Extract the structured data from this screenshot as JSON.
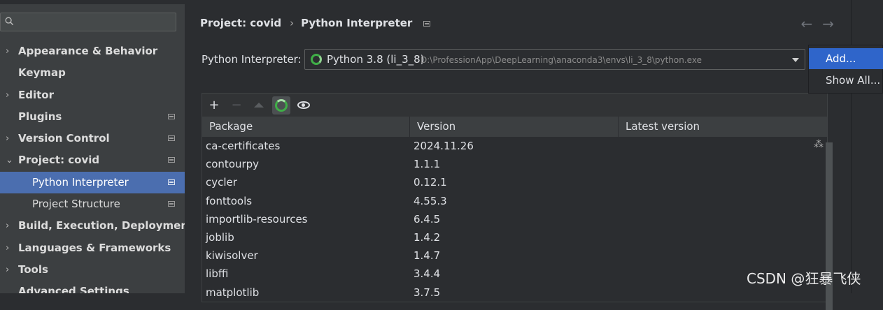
{
  "sidebar": {
    "search_placeholder": "",
    "items": [
      {
        "label": "Appearance & Behavior",
        "arrow": "›"
      },
      {
        "label": "Keymap"
      },
      {
        "label": "Editor",
        "arrow": "›"
      },
      {
        "label": "Plugins"
      },
      {
        "label": "Version Control",
        "arrow": "›"
      },
      {
        "label": "Project: covid",
        "arrow": "⌄"
      },
      {
        "label": "Python Interpreter"
      },
      {
        "label": "Project Structure"
      },
      {
        "label": "Build, Execution, Deployment",
        "arrow": "›"
      },
      {
        "label": "Languages & Frameworks",
        "arrow": "›"
      },
      {
        "label": "Tools",
        "arrow": "›"
      },
      {
        "label": "Advanced Settings"
      }
    ]
  },
  "breadcrumb": {
    "project": "Project: covid",
    "separator": "›",
    "page": "Python Interpreter"
  },
  "nav": {
    "back": "←",
    "forward": "→"
  },
  "interpreter": {
    "label": "Python Interpreter:",
    "name": "Python 3.8 (li_3_8)",
    "path": "D:\\ProfessionApp\\DeepLearning\\anaconda3\\envs\\li_3_8\\python.exe"
  },
  "toolbar": {
    "add": "+",
    "remove": "−"
  },
  "table": {
    "columns": [
      "Package",
      "Version",
      "Latest version"
    ],
    "rows": [
      {
        "package": "ca-certificates",
        "version": "2024.11.26"
      },
      {
        "package": "contourpy",
        "version": "1.1.1"
      },
      {
        "package": "cycler",
        "version": "0.12.1"
      },
      {
        "package": "fonttools",
        "version": "4.55.3"
      },
      {
        "package": "importlib-resources",
        "version": "6.4.5"
      },
      {
        "package": "joblib",
        "version": "1.4.2"
      },
      {
        "package": "kiwisolver",
        "version": "1.4.7"
      },
      {
        "package": "libffi",
        "version": "3.4.4"
      },
      {
        "package": "matplotlib",
        "version": "3.7.5"
      }
    ],
    "loading_glyph": "⁂"
  },
  "menu": {
    "add": "Add...",
    "show_all": "Show All..."
  },
  "watermark": "CSDN @狂暴飞侠",
  "colors": {
    "selection": "#4b6eaf",
    "menu_highlight": "#2f65ca",
    "interpreter_icon": "#3fae47"
  }
}
